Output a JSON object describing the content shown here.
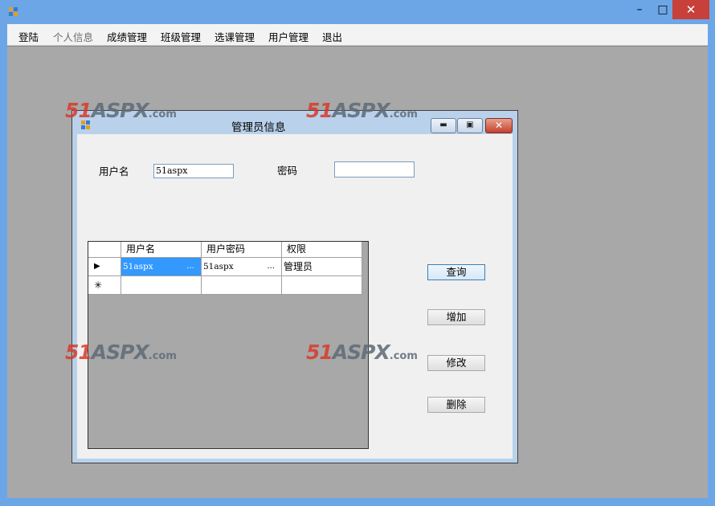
{
  "menubar": {
    "items": [
      {
        "label": "登陆",
        "enabled": true
      },
      {
        "label": "个人信息",
        "enabled": false
      },
      {
        "label": "成绩管理",
        "enabled": true
      },
      {
        "label": "班级管理",
        "enabled": true
      },
      {
        "label": "选课管理",
        "enabled": true
      },
      {
        "label": "用户管理",
        "enabled": true
      },
      {
        "label": "退出",
        "enabled": true
      }
    ]
  },
  "outer_window": {
    "controls": {
      "minimize": "–",
      "maximize": "□",
      "close": "✕"
    }
  },
  "watermark": {
    "number": "51",
    "brand": "ASPX",
    "suffix": ".com"
  },
  "child_window": {
    "title": "管理员信息",
    "controls": {
      "minimize": "▬",
      "maximize": "▣",
      "close": "✕"
    },
    "form": {
      "username_label": "用户名",
      "username_value": "51aspx",
      "password_label": "密码",
      "password_value": ""
    },
    "grid": {
      "columns": [
        "用户名",
        "用户密码",
        "权限"
      ],
      "rows": [
        {
          "cells": [
            "51aspx",
            "51aspx",
            "管理员"
          ],
          "indicator": "▶",
          "selected": true
        }
      ],
      "new_row_indicator": "✳",
      "ellipsis": "..."
    },
    "buttons": {
      "query": "查询",
      "add": "增加",
      "edit": "修改",
      "delete": "删除"
    }
  },
  "colors": {
    "titlebar": "#6da6e6",
    "mdi_background": "#a8a8a8",
    "close_button": "#c7403a",
    "selection": "#3399ff"
  }
}
